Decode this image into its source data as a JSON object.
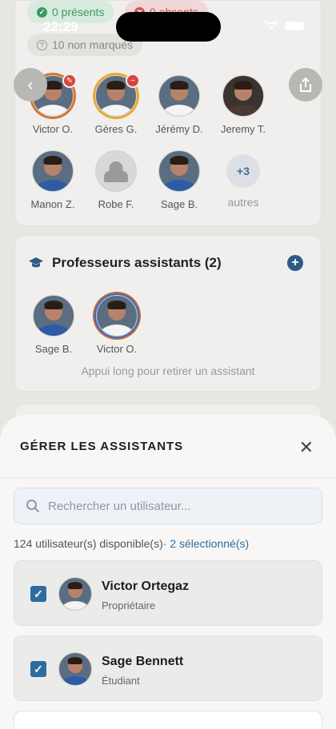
{
  "status": {
    "time": "22:29"
  },
  "attendance": {
    "present": "0 présents",
    "absent": "0 absents",
    "unmarked": "10 non marqués"
  },
  "participants": [
    {
      "name": "Victor O."
    },
    {
      "name": "Gères G."
    },
    {
      "name": "Jérémy D."
    },
    {
      "name": "Jeremy T."
    },
    {
      "name": "Manon Z."
    },
    {
      "name": "Robe F."
    },
    {
      "name": "Sage B."
    }
  ],
  "more": {
    "count": "+3",
    "label": "autres"
  },
  "assistants_card": {
    "title": "Professeurs assistants (2)",
    "add_symbol": "+",
    "assistants": [
      {
        "name": "Sage B."
      },
      {
        "name": "Victor O."
      }
    ],
    "hint": "Appui long pour retirer un assistant"
  },
  "sheet": {
    "title": "GÉRER LES ASSISTANTS",
    "close_symbol": "✕",
    "search_placeholder": "Rechercher un utilisateur...",
    "available": "124 utilisateur(s) disponible(s)",
    "selected": "· 2 sélectionné(s)",
    "users": [
      {
        "name": "Victor Ortegaz",
        "role": "Propriétaire",
        "checked": true
      },
      {
        "name": "Sage Bennett",
        "role": "Étudiant",
        "checked": true
      }
    ]
  },
  "colors": {
    "accent": "#2f6c9e",
    "present": "#3c9a62",
    "absent": "#c85050"
  },
  "icons": [
    "back-chevron-icon",
    "share-icon",
    "graduation-cap-icon",
    "plus-icon",
    "close-icon",
    "search-icon",
    "checkbox-checked-icon",
    "wifi-icon",
    "battery-icon"
  ]
}
